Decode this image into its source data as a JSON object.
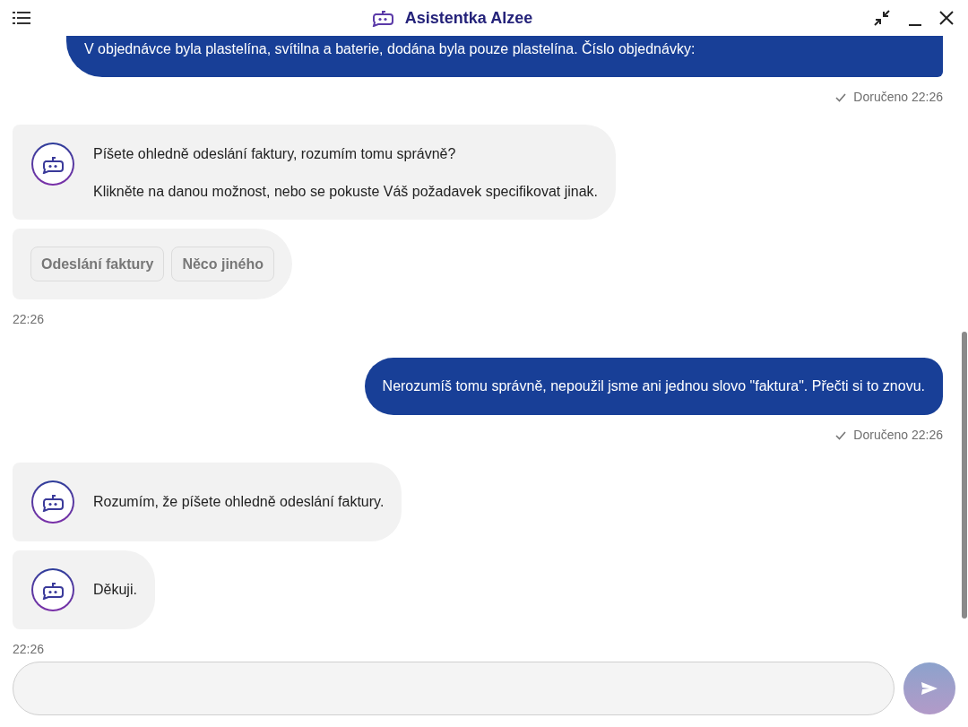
{
  "header": {
    "title": "Asistentka Alzee"
  },
  "messages": [
    {
      "kind": "user",
      "text": "V objednávce byla plastelína, svítilna a baterie, dodána byla pouze plastelína. Číslo objednávky:",
      "status": "Doručeno 22:26"
    },
    {
      "kind": "bot",
      "paragraphs": [
        "Píšete ohledně odeslání faktury, rozumím tomu správně?",
        "Klikněte na danou možnost, nebo se pokuste Váš požadavek specifikovat jinak."
      ]
    },
    {
      "kind": "options",
      "options": [
        "Odeslání faktury",
        "Něco jiného"
      ]
    },
    {
      "kind": "time",
      "text": "22:26"
    },
    {
      "kind": "user",
      "text": "Nerozumíš tomu správně, nepoužil jsme ani jednou slovo \"faktura\". Přečti si to znovu.",
      "status": "Doručeno 22:26"
    },
    {
      "kind": "bot",
      "paragraphs": [
        "Rozumím, že píšete ohledně odeslání faktury."
      ]
    },
    {
      "kind": "bot",
      "paragraphs": [
        "Děkuji."
      ]
    },
    {
      "kind": "time",
      "text": "22:26"
    }
  ]
}
